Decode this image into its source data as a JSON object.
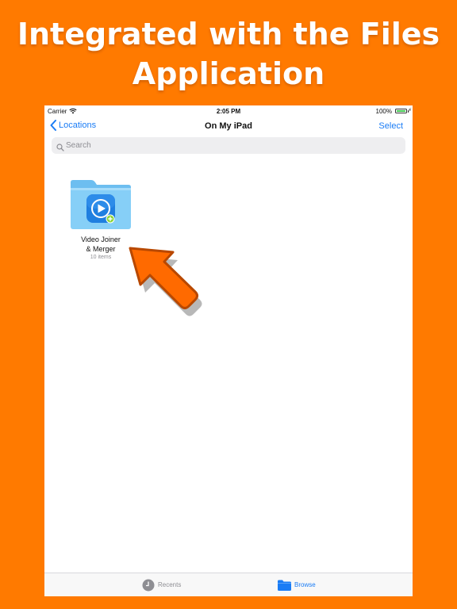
{
  "promo": {
    "headline_line1": "Integrated with the Files",
    "headline_line2": "Application",
    "background_color": "#FF7A00"
  },
  "status_bar": {
    "carrier": "Carrier",
    "time": "2:05 PM",
    "battery": "100%"
  },
  "nav": {
    "back_label": "Locations",
    "title": "On My iPad",
    "select_label": "Select"
  },
  "search": {
    "placeholder": "Search"
  },
  "folder": {
    "name_line1": "Video Joiner",
    "name_line2": "& Merger",
    "count": "10 items",
    "icon": "video-folder-icon"
  },
  "tabs": [
    {
      "label": "Recents",
      "icon": "clock-icon",
      "active": false
    },
    {
      "label": "Browse",
      "icon": "folder-icon",
      "active": true
    }
  ],
  "colors": {
    "accent": "#1a7cf5",
    "folder": "#7cc8f5",
    "arrow": "#FF6A00"
  }
}
